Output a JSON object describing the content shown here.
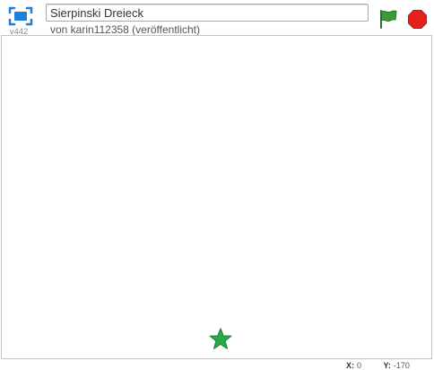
{
  "header": {
    "project_title": "Sierpinski Dreieck",
    "author_line": "von karin112358 (veröffentlicht)",
    "version": "v442"
  },
  "controls": {
    "fullscreen_icon": "fullscreen-icon",
    "green_flag_icon": "green-flag-icon",
    "stop_icon": "stop-sign-icon"
  },
  "stage": {
    "sprite_icon": "star-sprite",
    "sprite_color": "#2aa84a"
  },
  "coordinates": {
    "x_label": "X:",
    "x_value": "0",
    "y_label": "Y:",
    "y_value": "-170"
  },
  "colors": {
    "flag": "#2f8a2f",
    "stop": "#e0201d",
    "fullscreen": "#1f7fd6"
  }
}
